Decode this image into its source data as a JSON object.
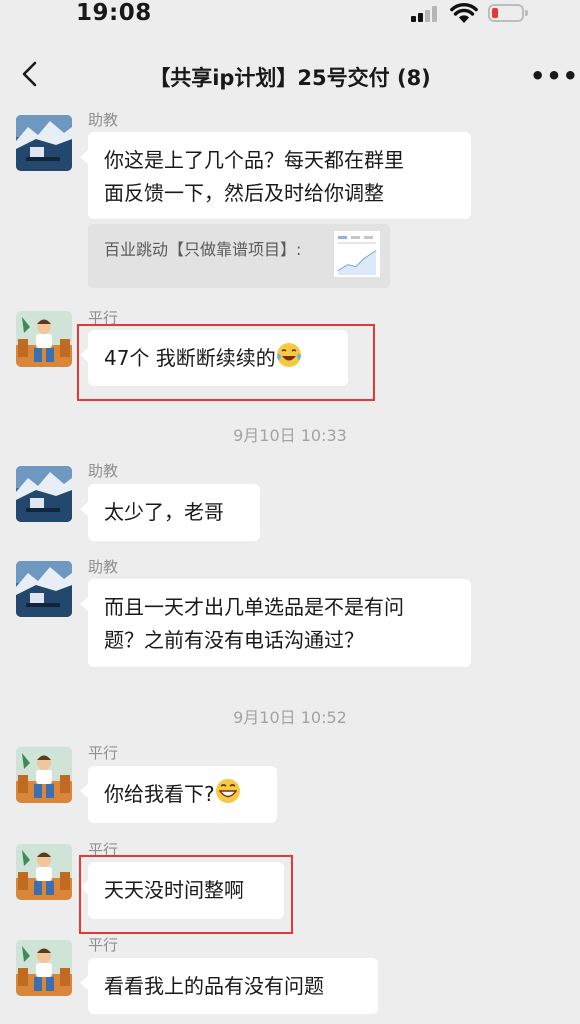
{
  "status_bar": {
    "time": "19:08",
    "battery_color": "#e53935"
  },
  "header": {
    "title": "【共享ip计划】25号交付 (8)",
    "back_icon": "chevron-left-icon",
    "more_icon": "ellipsis-icon"
  },
  "messages": [
    {
      "sender": "助教",
      "text": "你这是上了几个品？每天都在群里面反馈一下，然后及时给你调整",
      "lines": [
        "你这是上了几个品？每天都在群里",
        "面反馈一下，然后及时给你调整"
      ],
      "quote": "百业跳动【只做靠谱项目】:"
    },
    {
      "sender": "平行",
      "text": "47个 我断断续续的",
      "emoji": "laughing-tears-emoji",
      "highlighted": true
    },
    {
      "timestamp": "9月10日 10:33"
    },
    {
      "sender": "助教",
      "text": "太少了，老哥"
    },
    {
      "sender": "助教",
      "text": "而且一天才出几单选品是不是有问题？之前有没有电话沟通过？",
      "lines": [
        "而且一天才出几单选品是不是有问",
        "题？之前有没有电话沟通过？"
      ]
    },
    {
      "timestamp": "9月10日 10:52"
    },
    {
      "sender": "平行",
      "text": "你给我看下?",
      "emoji": "grinning-emoji"
    },
    {
      "sender": "平行",
      "text": "天天没时间整啊",
      "highlighted": true
    },
    {
      "sender": "平行",
      "text": "看看我上的品有没有问题"
    }
  ],
  "highlight_color": "#e53935"
}
